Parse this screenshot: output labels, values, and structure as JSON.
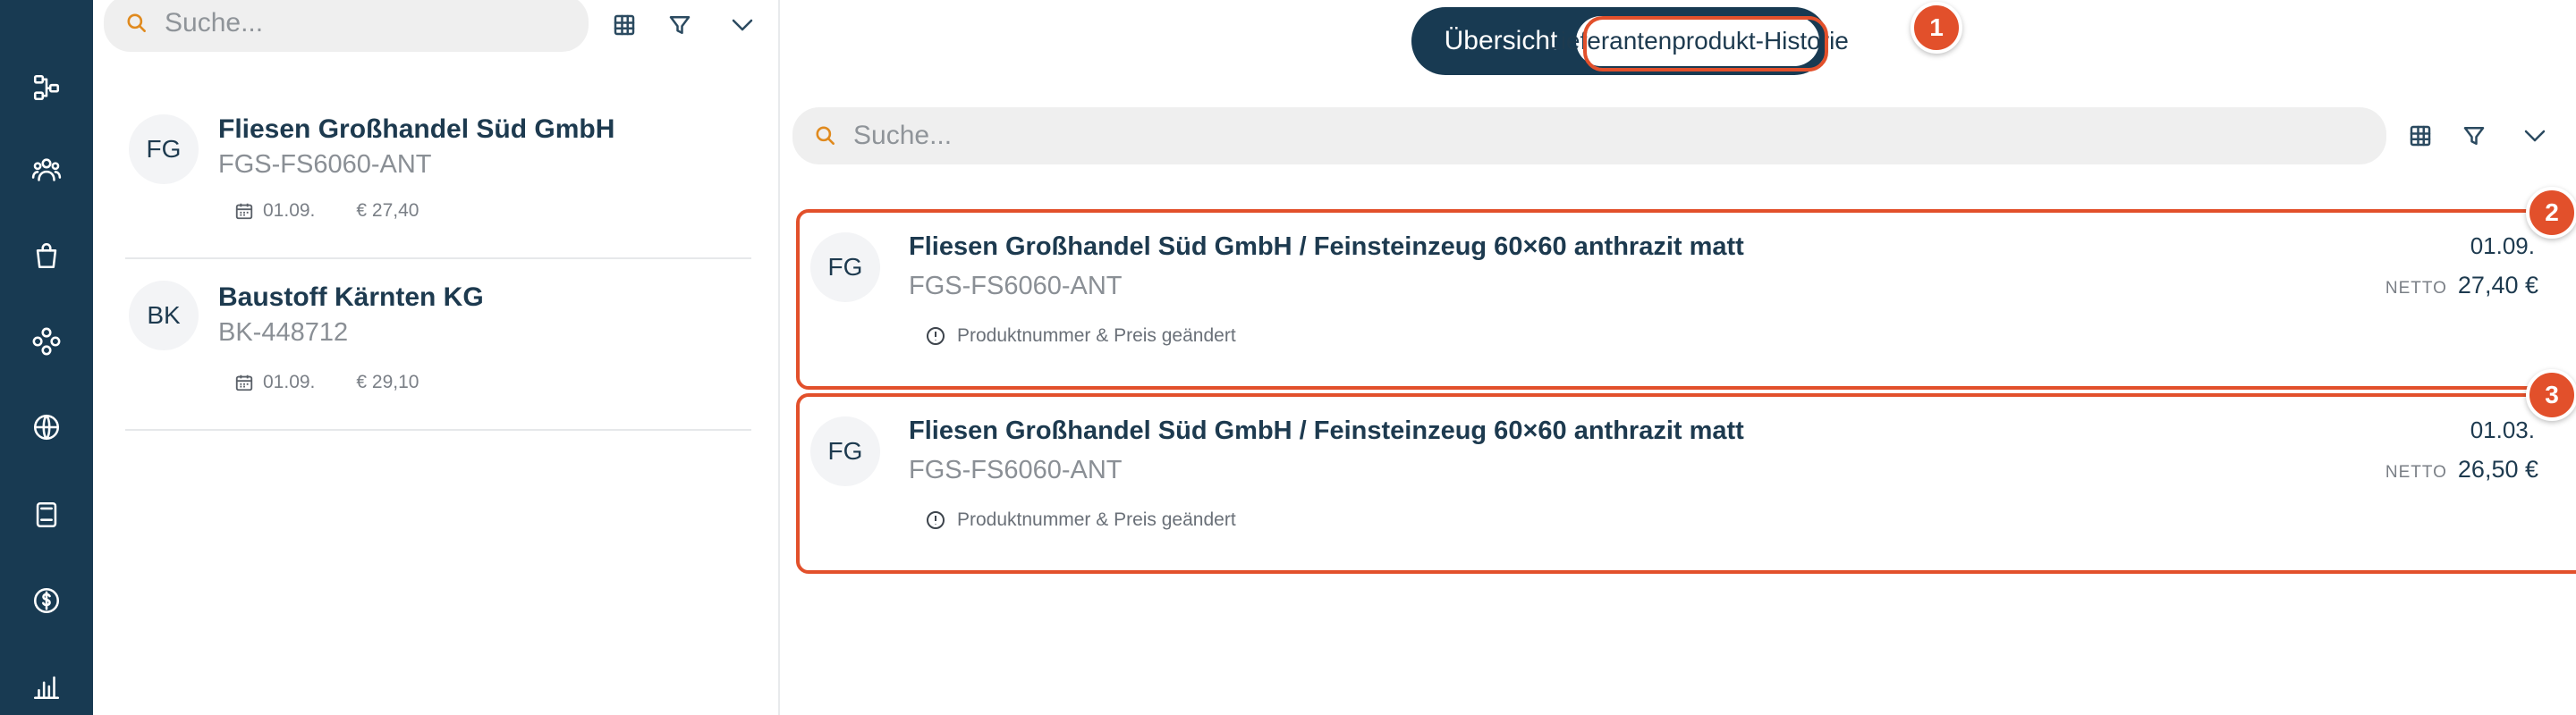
{
  "sidebar": {
    "icons": [
      "hierarchy-icon",
      "users-icon",
      "shopping-bag-icon",
      "modules-icon",
      "globe-icon",
      "book-icon",
      "dollar-icon",
      "bar-chart-icon"
    ]
  },
  "left_panel": {
    "search": {
      "placeholder": "Suche..."
    },
    "items": [
      {
        "initials": "FG",
        "title": "Fliesen Großhandel Süd GmbH",
        "code": "FGS-FS6060-ANT",
        "date": "01.09.",
        "price": "€ 27,40"
      },
      {
        "initials": "BK",
        "title": "Baustoff Kärnten KG",
        "code": "BK-448712",
        "date": "01.09.",
        "price": "€ 29,10"
      }
    ]
  },
  "right_panel": {
    "tabs": {
      "overview": "Übersicht",
      "history": "Lieferantenprodukt-Historie"
    },
    "search": {
      "placeholder": "Suche..."
    },
    "badges": [
      "1",
      "2",
      "3"
    ],
    "cards": [
      {
        "initials": "FG",
        "title": "Fliesen Großhandel Süd GmbH / Feinsteinzeug 60×60 anthrazit matt",
        "code": "FGS-FS6060-ANT",
        "note": "Produktnummer & Preis geändert",
        "date": "01.09.",
        "netto_label": "NETTO",
        "amount": "27,40 €"
      },
      {
        "initials": "FG",
        "title": "Fliesen Großhandel Süd GmbH / Feinsteinzeug 60×60 anthrazit matt",
        "code": "FGS-FS6060-ANT",
        "note": "Produktnummer & Preis geändert",
        "date": "01.03.",
        "netto_label": "NETTO",
        "amount": "26,50 €"
      }
    ]
  },
  "colors": {
    "sidebar": "#183a52",
    "accent": "#e2502b",
    "search_icon": "#e08a1e",
    "text": "#1d3a4f"
  }
}
